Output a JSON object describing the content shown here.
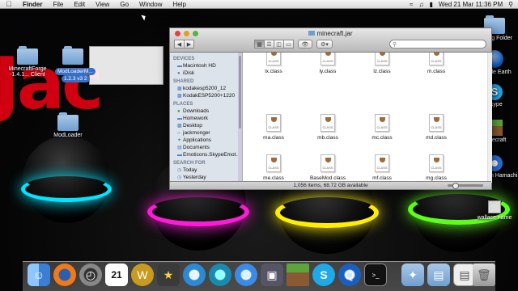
{
  "menubar": {
    "apple_icon": "apple-icon",
    "items": [
      "Finder",
      "File",
      "Edit",
      "View",
      "Go",
      "Window",
      "Help"
    ],
    "clock": "Wed 21 Mar  11:36 PM",
    "icons": [
      "wifi-icon",
      "volume-icon",
      "battery-icon",
      "spotlight-icon"
    ]
  },
  "desktop_left": [
    {
      "label": "MinecraftForge\n-1.4.1... Client"
    },
    {
      "label": "ModLoader"
    }
  ],
  "drag_ghost": {
    "label": "ModLoaderM...",
    "sub_label": "1.2.3 v3 2"
  },
  "desktop_right": [
    {
      "label": "Mailing Folder"
    },
    {
      "label": "Google Earth"
    },
    {
      "label": "Skype"
    },
    {
      "label": "Minecraft"
    },
    {
      "label": "LogMeIn Hamachi"
    },
    {
      "label": "wallace name"
    }
  ],
  "window": {
    "title": "minecraft.jar",
    "search_placeholder": "",
    "status": "1,056 items, 68.72 GB available",
    "sidebar": {
      "devices_header": "DEVICES",
      "devices": [
        "Macintosh HD",
        "iDisk"
      ],
      "shared_header": "SHARED",
      "shared": [
        "kodakesp5200_12",
        "KodakESP5200+1220"
      ],
      "places_header": "PLACES",
      "places": [
        "Downloads",
        "Homework",
        "Desktop",
        "jackmonger",
        "Applications",
        "Documents",
        "Emoticons.SkypeEmot..."
      ],
      "search_header": "SEARCH FOR",
      "search": [
        "Today",
        "Yesterday"
      ]
    },
    "files": [
      [
        "lx.class",
        "ly.class",
        "lz.class",
        "m.class"
      ],
      [
        "ma.class",
        "mb.class",
        "mc.class",
        "md.class"
      ],
      [
        "me.class",
        "BaseMod.class",
        "mf.class",
        "mg.class"
      ]
    ]
  },
  "dock_items": [
    "finder-icon",
    "firefox-icon",
    "dashboard-icon",
    "calendar-icon",
    "wacom-icon",
    "imovie-icon",
    "safari-icon",
    "itunes-icon",
    "iphoto-icon",
    "minecraft-icon",
    "skype-icon",
    "quicktime-icon",
    "terminal-icon",
    "applications-folder-icon",
    "documents-folder-icon",
    "file-icon",
    "trash-icon"
  ],
  "colors": {
    "cyan": "#00e5ff",
    "magenta": "#ff1ad9",
    "yellow": "#ffee00",
    "green": "#5cff1a",
    "red_text": "#d00010"
  }
}
